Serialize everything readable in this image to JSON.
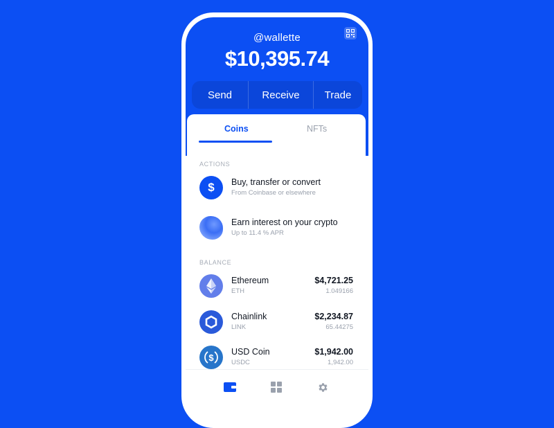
{
  "header": {
    "username": "@wallette",
    "balance": "$10,395.74",
    "qr_icon": "qr-code-icon"
  },
  "quick_actions": {
    "send": "Send",
    "receive": "Receive",
    "trade": "Trade"
  },
  "tabs": [
    {
      "label": "Coins",
      "active": true
    },
    {
      "label": "NFTs",
      "active": false
    }
  ],
  "actions_section": {
    "label": "ACTIONS",
    "items": [
      {
        "title": "Buy, transfer or convert",
        "subtitle": "From Coinbase or elsewhere",
        "icon": "dollar-icon"
      },
      {
        "title": "Earn interest on your crypto",
        "subtitle": "Up to 11.4 % APR",
        "icon": "earn-blob-icon"
      }
    ]
  },
  "balance_section": {
    "label": "BALANCE",
    "assets": [
      {
        "name": "Ethereum",
        "symbol": "ETH",
        "value": "$4,721.25",
        "amount": "1.049166",
        "icon": "ethereum-icon"
      },
      {
        "name": "Chainlink",
        "symbol": "LINK",
        "value": "$2,234.87",
        "amount": "65.44275",
        "icon": "chainlink-icon"
      },
      {
        "name": "USD Coin",
        "symbol": "USDC",
        "value": "$1,942.00",
        "amount": "1,942.00",
        "icon": "usd-coin-icon"
      }
    ]
  },
  "bottom_nav": [
    {
      "icon": "wallet-icon",
      "active": true
    },
    {
      "icon": "grid-icon",
      "active": false
    },
    {
      "icon": "gear-icon",
      "active": false
    }
  ],
  "colors": {
    "brand": "#0c4ff3",
    "background": "#0c4ff3",
    "text": "#111722",
    "muted": "#9aa1ad",
    "ethereum": "#627eea",
    "chainlink": "#2a5ada",
    "usdc": "#2775ca"
  }
}
